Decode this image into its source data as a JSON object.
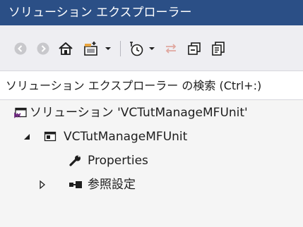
{
  "window": {
    "title": "ソリューション エクスプローラー"
  },
  "toolbar": {
    "buttons": [
      {
        "name": "back-button",
        "icon": "back-circle-icon"
      },
      {
        "name": "forward-button",
        "icon": "forward-circle-icon"
      },
      {
        "name": "home-button",
        "icon": "home-icon"
      },
      {
        "name": "switch-views-button",
        "icon": "switch-views-icon"
      },
      {
        "name": "switch-views-dropdown",
        "icon": "chevron-down-icon"
      },
      {
        "name": "pending-changes-button",
        "icon": "clock-icon"
      },
      {
        "name": "pending-changes-dropdown",
        "icon": "chevron-down-icon"
      },
      {
        "name": "sync-button",
        "icon": "sync-icon"
      },
      {
        "name": "collapse-all-button",
        "icon": "collapse-all-icon"
      },
      {
        "name": "show-all-files-button",
        "icon": "show-all-files-icon"
      }
    ]
  },
  "search": {
    "placeholder": "ソリューション エクスプローラー の検索 (Ctrl+:)"
  },
  "tree": {
    "solution": "ソリューション 'VCTutManageMFUnit'",
    "project": "VCTutManageMFUnit",
    "properties": "Properties",
    "references": "参照設定"
  },
  "colors": {
    "title_bar": "#2b4f86",
    "toolbar_bg": "#eeeef2",
    "pane_bg": "#f5f5f5",
    "vs_purple": "#68217a",
    "sync_icon_disabled": "#e0a8a0"
  }
}
